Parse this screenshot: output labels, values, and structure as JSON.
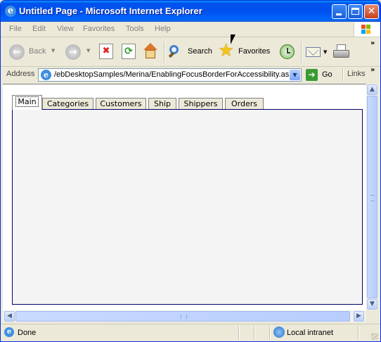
{
  "window": {
    "title": "Untitled Page - Microsoft Internet Explorer"
  },
  "menubar": {
    "items": [
      "File",
      "Edit",
      "View",
      "Favorites",
      "Tools",
      "Help"
    ]
  },
  "toolbar": {
    "back_label": "Back",
    "search_label": "Search",
    "favorites_label": "Favorites"
  },
  "address": {
    "label": "Address",
    "value": "/ebDesktopSamples/Merina/EnablingFocusBorderForAccessibility.aspx",
    "go_label": "Go",
    "links_label": "Links"
  },
  "tabs": [
    {
      "label": "Main",
      "active": true
    },
    {
      "label": "Categories",
      "active": false
    },
    {
      "label": "Customers",
      "active": false
    },
    {
      "label": "Ship",
      "active": false
    },
    {
      "label": "Shippers",
      "active": false
    },
    {
      "label": "Orders",
      "active": false
    }
  ],
  "status": {
    "text": "Done",
    "zone": "Local intranet"
  },
  "colors": {
    "titlebar": "#0053ee",
    "panel_border": "#000066",
    "chrome": "#ece9d8"
  }
}
